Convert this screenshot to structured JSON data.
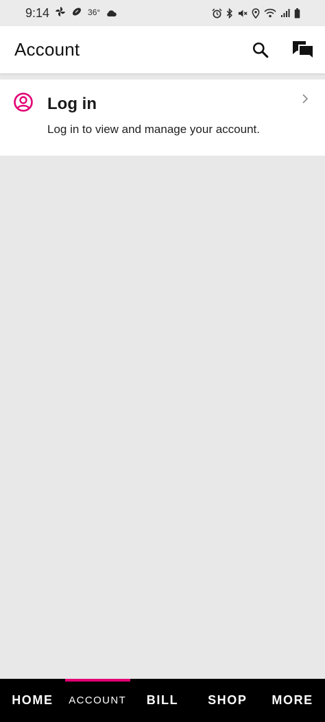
{
  "status_bar": {
    "time": "9:14",
    "temperature": "36°",
    "icons": [
      "pinwheel-icon",
      "football-icon",
      "cloud-icon",
      "alarm-icon",
      "bluetooth-icon",
      "mute-icon",
      "location-icon",
      "wifi-icon",
      "signal-icon",
      "battery-icon"
    ]
  },
  "app_bar": {
    "title": "Account",
    "actions": [
      "search-icon",
      "chat-icon"
    ]
  },
  "login": {
    "title": "Log in",
    "description": "Log in to view and manage your account.",
    "icon": "user-circle-icon"
  },
  "bottom_nav": {
    "tabs": [
      {
        "label": "HOME"
      },
      {
        "label": "ACCOUNT"
      },
      {
        "label": "BILL"
      },
      {
        "label": "SHOP"
      },
      {
        "label": "MORE"
      }
    ],
    "active": "ACCOUNT"
  },
  "colors": {
    "accent": "#e20074",
    "nav_background": "#000000",
    "page_background": "#e8e8e8"
  }
}
